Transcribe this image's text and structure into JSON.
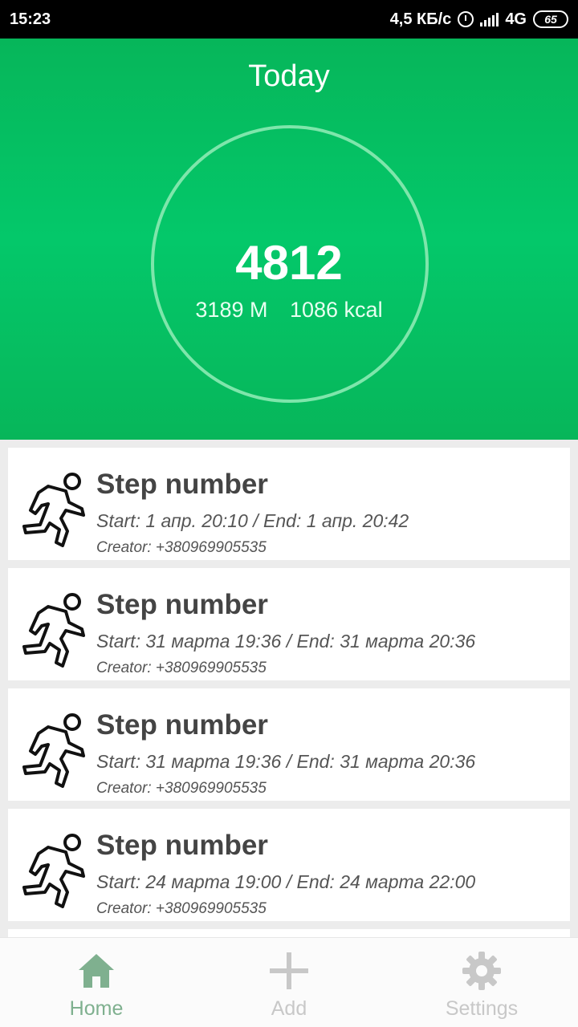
{
  "status_bar": {
    "time": "15:23",
    "speed": "4,5 КБ/с",
    "network": "4G",
    "battery": "65"
  },
  "header": {
    "title": "Today",
    "steps": "4812",
    "distance": "3189 M",
    "calories": "1086 kcal"
  },
  "records": [
    {
      "title": "Step number",
      "time": "Start: 1 апр. 20:10 / End: 1 апр. 20:42",
      "creator": "Creator: +380969905535"
    },
    {
      "title": "Step number",
      "time": "Start: 31 марта 19:36 / End: 31 марта 20:36",
      "creator": "Creator: +380969905535"
    },
    {
      "title": "Step number",
      "time": "Start: 31 марта 19:36 / End: 31 марта 20:36",
      "creator": "Creator: +380969905535"
    },
    {
      "title": "Step number",
      "time": "Start: 24 марта 19:00 / End: 24 марта 22:00",
      "creator": "Creator: +380969905535"
    }
  ],
  "nav": {
    "home": "Home",
    "add": "Add",
    "settings": "Settings"
  },
  "colors": {
    "header_green": "#04c86a",
    "ring": "#7ee6ab",
    "nav_active": "#7fb08f",
    "nav_inactive": "#c8c8c8"
  },
  "icons": {
    "record": "running-person-icon",
    "home": "home-icon",
    "add": "plus-icon",
    "settings": "gear-icon"
  }
}
